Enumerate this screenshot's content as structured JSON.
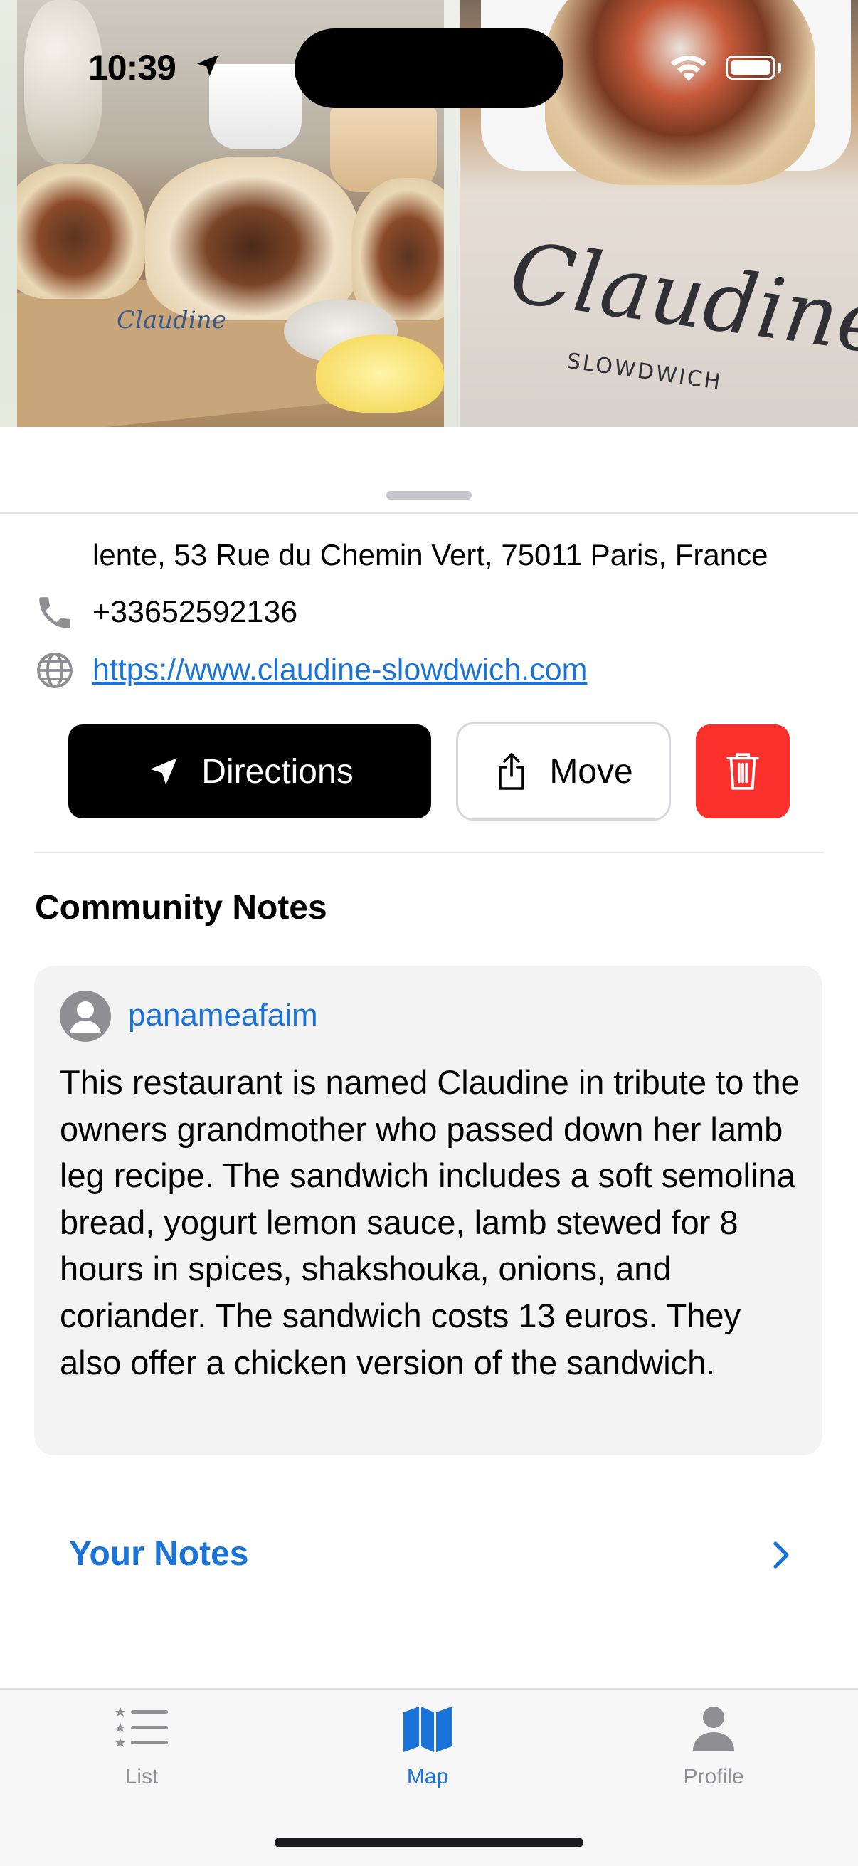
{
  "status_bar": {
    "time": "10:39"
  },
  "place": {
    "address": "lente, 53 Rue du Chemin Vert, 75011 Paris, France",
    "phone": "+33652592136",
    "website": "https://www.claudine-slowdwich.com",
    "photo_brand": "Claudine",
    "photo_tagline": "SLOWDWICH"
  },
  "actions": {
    "directions_label": "Directions",
    "move_label": "Move",
    "delete_color": "#fb2f2c"
  },
  "community_notes": {
    "title": "Community Notes",
    "notes": [
      {
        "username": "panameafaim",
        "text": "This restaurant is named Claudine in tribute to the owners grandmother who passed down her lamb leg recipe. The sandwich includes a soft semolina bread, yogurt lemon sauce, lamb stewed for 8 hours in spices, shakshouka, onions, and coriander. The sandwich costs 13 euros. They also offer a chicken version of the sandwich."
      }
    ]
  },
  "your_notes": {
    "label": "Your Notes"
  },
  "tab_bar": {
    "tabs": [
      {
        "label": "List",
        "icon": "list-icon",
        "active": false
      },
      {
        "label": "Map",
        "icon": "map-icon",
        "active": true
      },
      {
        "label": "Profile",
        "icon": "person-icon",
        "active": false
      }
    ]
  },
  "colors": {
    "accent": "#1a73d9",
    "primary_button": "#000000",
    "destructive": "#fb2f2c"
  }
}
